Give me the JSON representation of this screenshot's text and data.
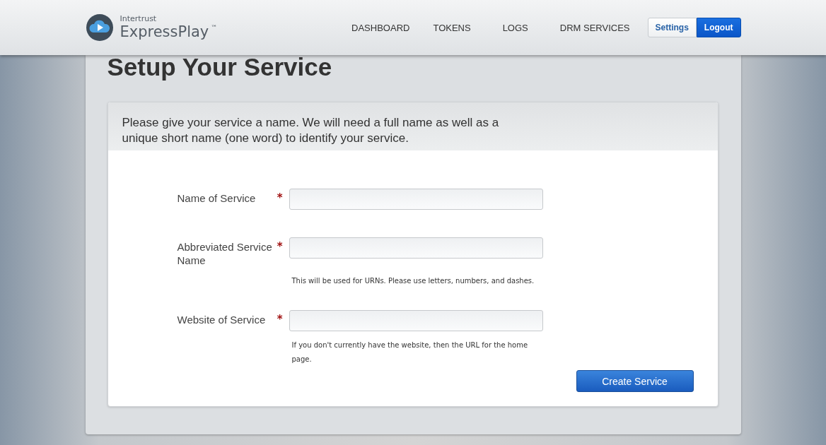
{
  "logo": {
    "company": "Intertrust",
    "product": "ExpressPlay",
    "mark": "™"
  },
  "nav": [
    {
      "label": "DASHBOARD"
    },
    {
      "label": "TOKENS"
    },
    {
      "label": "LOGS"
    },
    {
      "label": "DRM SERVICES"
    }
  ],
  "header_buttons": [
    {
      "label": "Settings",
      "kind": "secondary"
    },
    {
      "label": "Logout",
      "kind": "primary"
    }
  ],
  "title": "Setup Your Service",
  "intro": "Please give your service a name. We will need a full name as well as a unique short name (one word) to identify your service.",
  "fields": [
    {
      "label": "Name of Service",
      "required_mark": "*"
    },
    {
      "label": "Abbreviated Service Name",
      "required_mark": "*",
      "help": "This will be used for URNs. Please use letters, numbers, and dashes."
    },
    {
      "label": "Website of Service",
      "required_mark": "*",
      "help": "If you don't currently have the website, then the URL for the home page."
    }
  ],
  "submit": "Create Service"
}
